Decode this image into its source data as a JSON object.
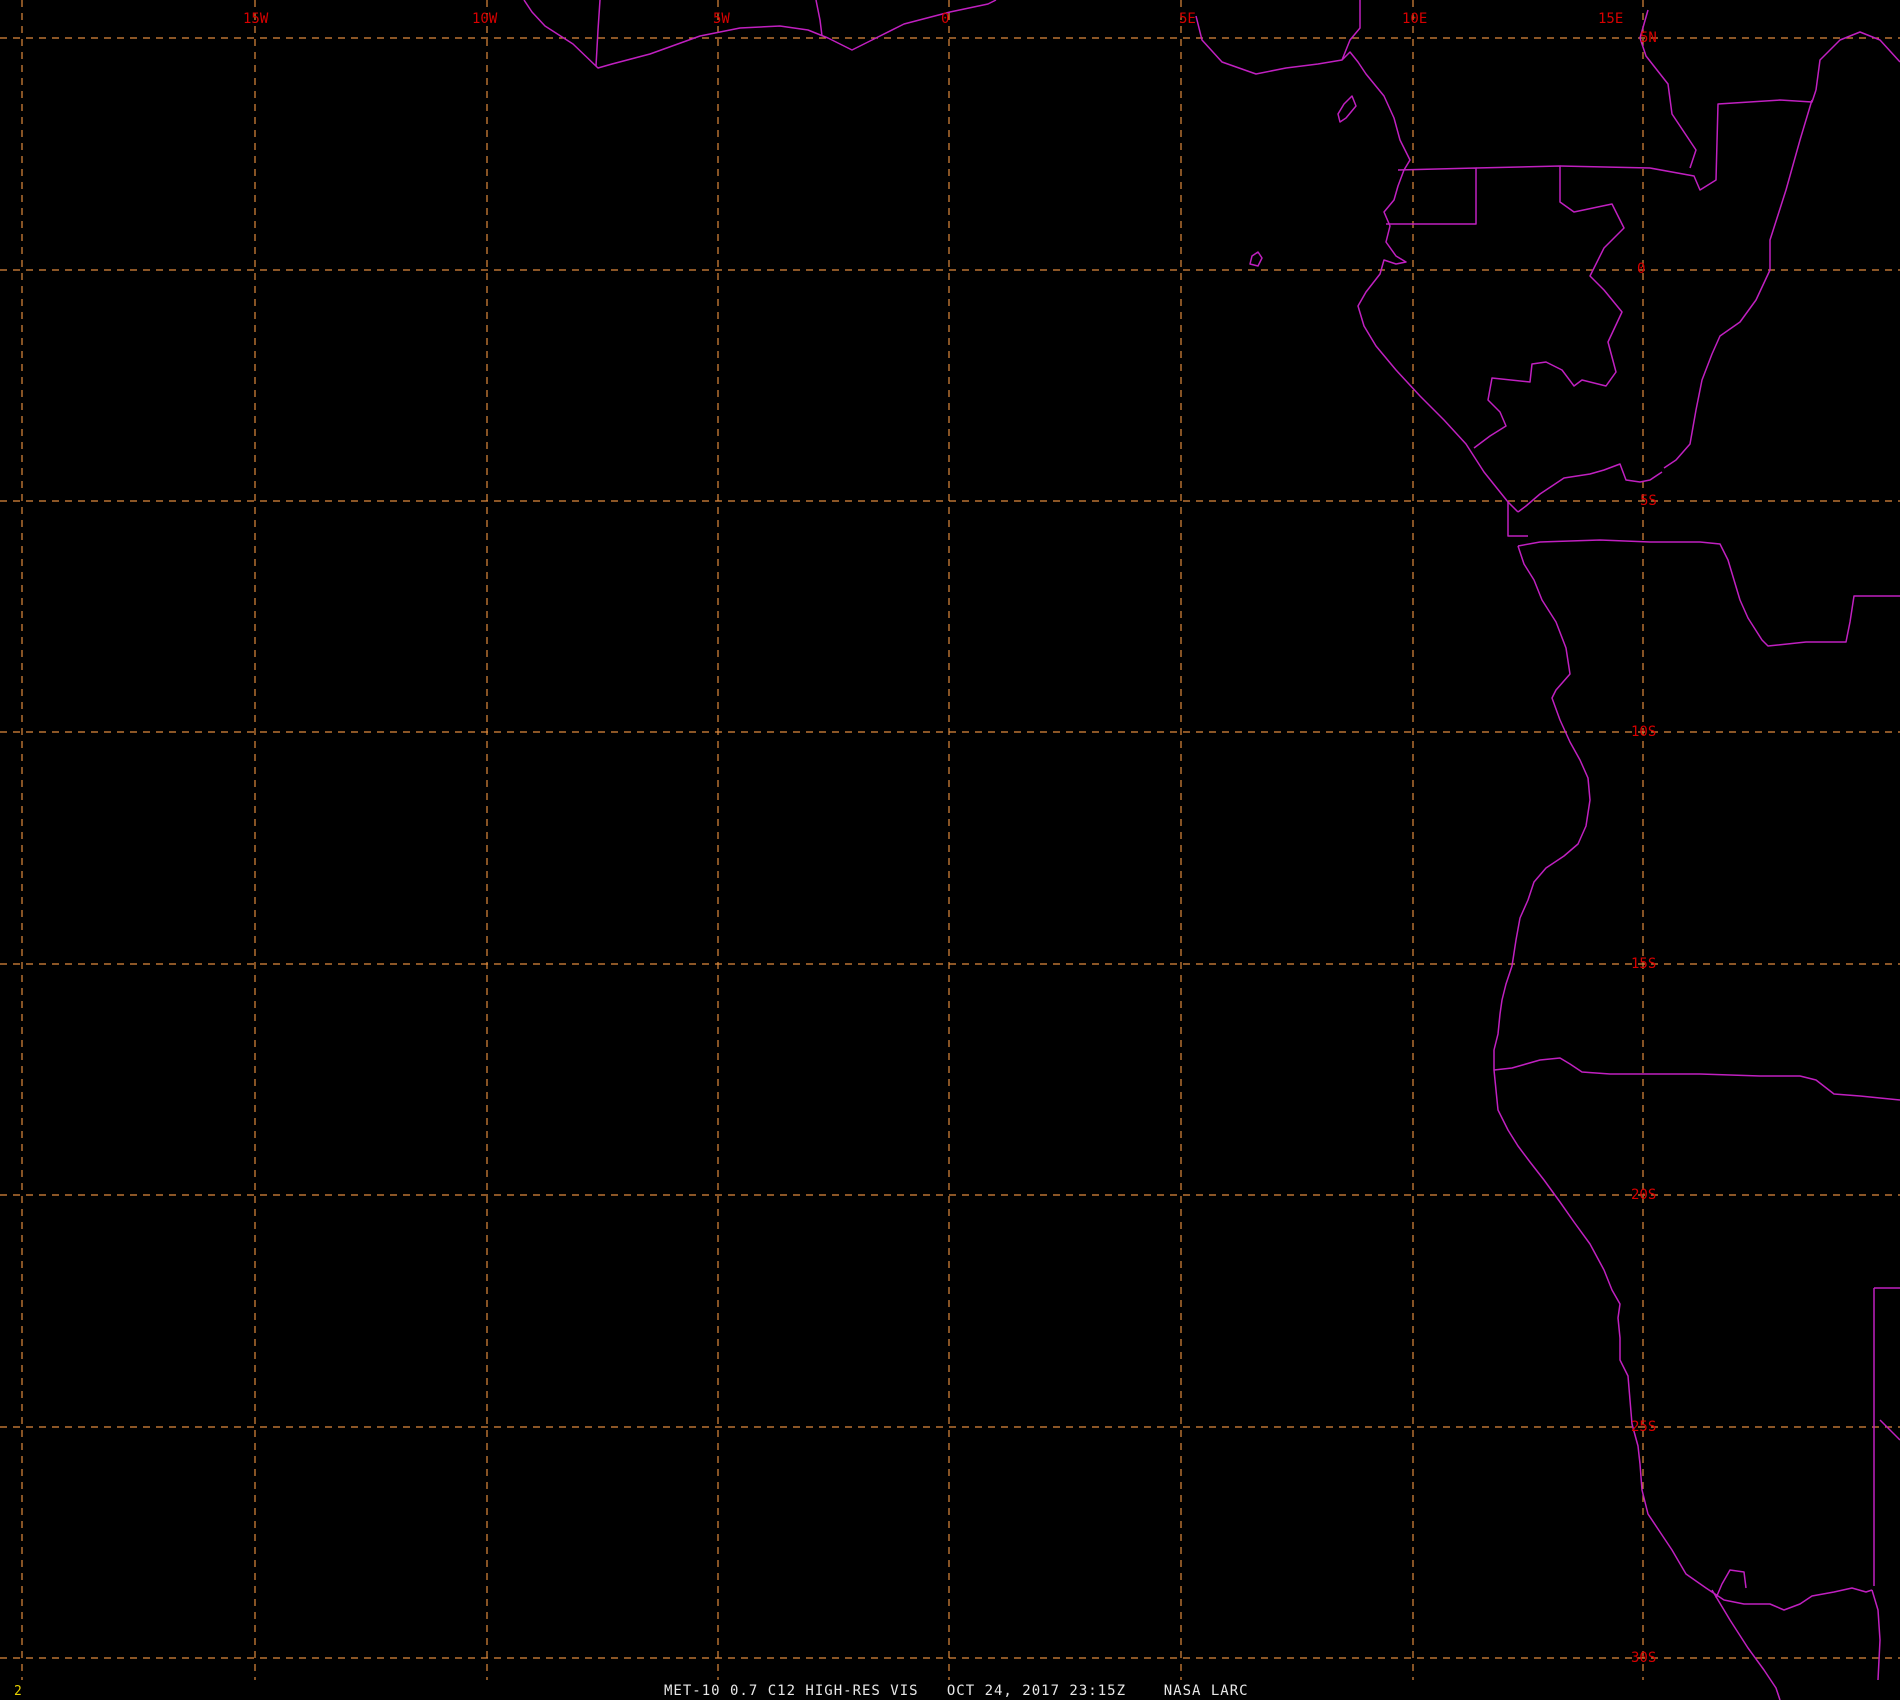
{
  "map": {
    "colors": {
      "background": "#000000",
      "grid": "#e08a3c",
      "coast": "#c020c0",
      "labels": "#d80000",
      "footer": "#e8e8e8",
      "frame_number": "#e6d000"
    },
    "longitude_labels": [
      "15W",
      "10W",
      "5W",
      "0",
      "5E",
      "10E",
      "15E"
    ],
    "latitude_labels": [
      "5N",
      "0",
      "5S",
      "10S",
      "15S",
      "20S",
      "25S",
      "30S"
    ]
  },
  "footer": {
    "frame_number": "2",
    "caption": "MET-10 0.7 C12 HIGH-RES VIS   OCT 24, 2017 23:15Z    NASA LARC"
  }
}
